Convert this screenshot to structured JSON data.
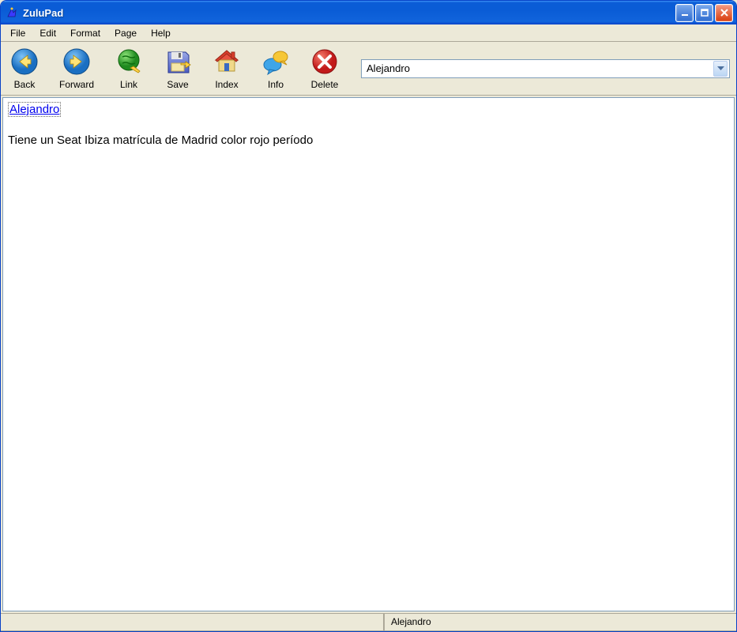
{
  "window": {
    "title": "ZuluPad"
  },
  "menu": {
    "items": [
      "File",
      "Edit",
      "Format",
      "Page",
      "Help"
    ]
  },
  "toolbar": {
    "back": "Back",
    "forward": "Forward",
    "link": "Link",
    "save": "Save",
    "index": "Index",
    "info": "Info",
    "delete": "Delete",
    "page_selector_value": "Alejandro"
  },
  "content": {
    "link_text": "Alejandro",
    "body": "Tiene un Seat Ibiza matrícula de Madrid color rojo período"
  },
  "statusbar": {
    "left": "",
    "right": "Alejandro"
  }
}
